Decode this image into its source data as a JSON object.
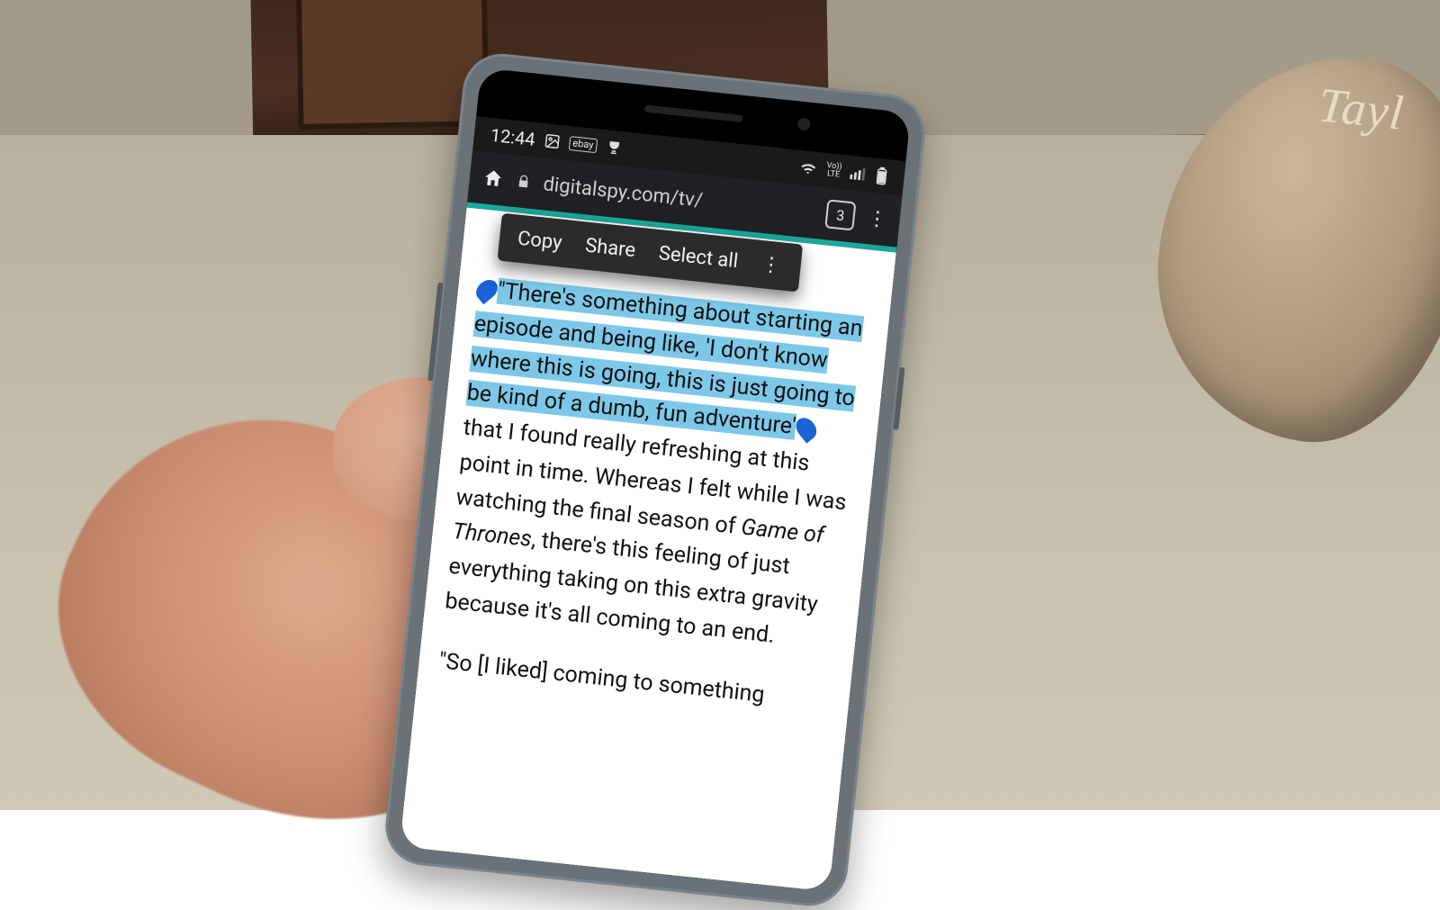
{
  "background": {
    "bag_brand_text": "Tayl"
  },
  "status_bar": {
    "time": "12:44",
    "left_icons": [
      "image-icon",
      "ebay-icon",
      "trophy-icon"
    ],
    "wifi": true,
    "volte_label": "Vo))\nLTE",
    "signal_bars": 3,
    "battery_pct_visual": 85
  },
  "browser": {
    "url_display": "digitalspy.com/tv/",
    "tab_count": "3",
    "accent_color": "#1aa89b"
  },
  "context_menu": {
    "items": [
      "Copy",
      "Share",
      "Select all"
    ],
    "has_overflow": true
  },
  "article": {
    "selected_text": "\"There's something about starting an episode and being like, 'I don't know where this is going, this is just going to be kind of a dumb, fun adventure'",
    "para1_highlighted_part": "\"There's something about starting an episode and being like, 'I don't know where this is going, this is just going to be kind of a dumb, fun adventure'",
    "para1_rest_a": " that I found really refreshing at this point in time. Whereas I felt while I was watching the final season of ",
    "para1_italic": "Game of Thrones",
    "para1_rest_b": ", there's this feeling of just everything taking on this extra gravity because it's all coming to an end.",
    "para2_visible": "\"So [I liked] coming to something"
  }
}
